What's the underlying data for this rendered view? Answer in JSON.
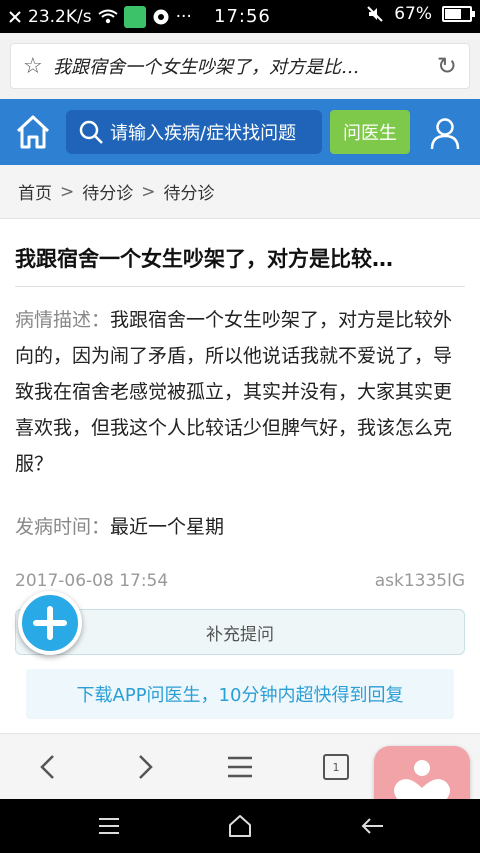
{
  "status_bar": {
    "speed": "23.2K/s",
    "time": "17:56",
    "dots": "···",
    "battery_text": "67%",
    "battery_level": 0.67
  },
  "browser": {
    "address_text": "我跟宿舍一个女生吵架了，对方是比…"
  },
  "header": {
    "search_placeholder": "请输入疾病/症状找问题",
    "ask_doctor_label": "问医生",
    "colors": {
      "header_bg": "#2e80d3",
      "search_bg": "#1f64b8",
      "ask_bg": "#7ec94a"
    }
  },
  "breadcrumb": {
    "items": [
      "首页",
      "待分诊",
      "待分诊"
    ],
    "separator": ">"
  },
  "question": {
    "title": "我跟宿舍一个女生吵架了，对方是比较…",
    "description_label": "病情描述：",
    "description": "我跟宿舍一个女生吵架了，对方是比较外向的，因为闹了矛盾，所以他说话我就不爱说了，导致我在宿舍老感觉被孤立，其实并没有，大家其实更喜欢我，但我这个人比较话少但脾气好，我该怎么克服？",
    "onset_label": "发病时间：",
    "onset": "最近一个星期",
    "date": "2017-06-08 17:54",
    "user": "ask1335lG"
  },
  "actions": {
    "supplement_label": "补充提问",
    "download_banner": "下载APP问医生，10分钟内超快得到回复"
  },
  "toolbar": {
    "tab_count": "1",
    "icons": [
      "back-icon",
      "forward-icon",
      "menu-icon",
      "tabs-icon"
    ]
  }
}
